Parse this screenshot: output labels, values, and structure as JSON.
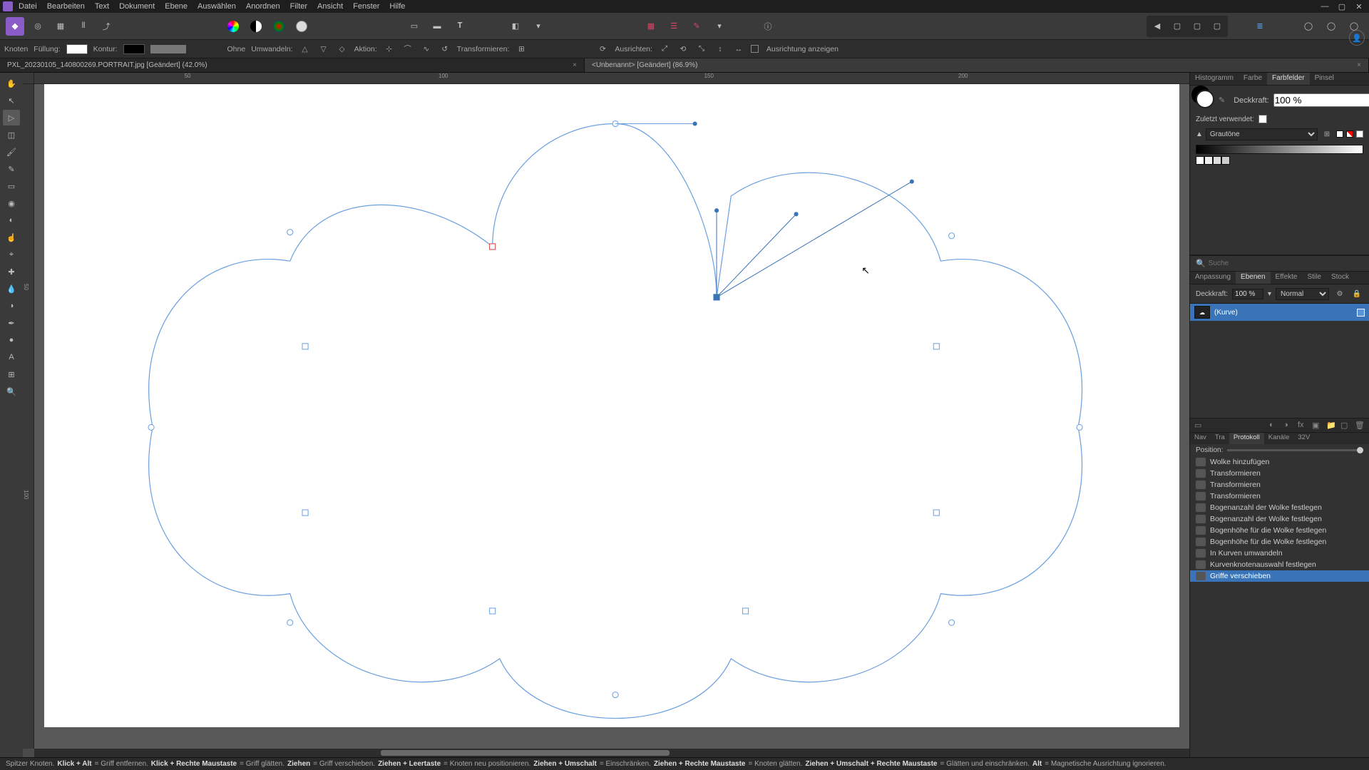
{
  "menu": [
    "Datei",
    "Bearbeiten",
    "Text",
    "Dokument",
    "Ebene",
    "Auswählen",
    "Anordnen",
    "Filter",
    "Ansicht",
    "Fenster",
    "Hilfe"
  ],
  "context": {
    "knoten": "Knoten",
    "fuellung": "Füllung:",
    "kontur": "Kontur:",
    "strokewidth": "Ohne",
    "umwandeln": "Umwandeln:",
    "aktion": "Aktion:",
    "transformieren": "Transformieren:",
    "ausrichten": "Ausrichten:",
    "ausrichtung_anzeigen": "Ausrichtung anzeigen"
  },
  "tabs": [
    {
      "label": "PXL_20230105_140800269.PORTRAIT.jpg [Geändert] (42.0%)",
      "active": false
    },
    {
      "label": "<Unbenannt> [Geändert] (86.9%)",
      "active": true
    }
  ],
  "right": {
    "toptabs": [
      "Histogramm",
      "Farbe",
      "Farbfelder",
      "Pinsel"
    ],
    "toptab_active": 2,
    "deckkraft_lbl": "Deckkraft:",
    "deckkraft_val": "100 %",
    "zuletzt": "Zuletzt verwendet:",
    "palette": "Grautöne",
    "search_ph": "Suche",
    "midtabs": [
      "Anpassung",
      "Ebenen",
      "Effekte",
      "Stile",
      "Stock"
    ],
    "midtab_active": 1,
    "layer_opacity_lbl": "Deckkraft:",
    "layer_opacity_val": "100 %",
    "blend": "Normal",
    "layer_name": "(Kurve)",
    "histtabs": [
      "Nav",
      "Tra",
      "Protokoll",
      "Kanäle",
      "32V"
    ],
    "histtab_active": 2,
    "position": "Position:",
    "history": [
      "Wolke hinzufügen",
      "Transformieren",
      "Transformieren",
      "Transformieren",
      "Bogenanzahl der Wolke festlegen",
      "Bogenanzahl der Wolke festlegen",
      "Bogenhöhe für die Wolke festlegen",
      "Bogenhöhe für die Wolke festlegen",
      "In Kurven umwandeln",
      "Kurvenknotenauswahl festlegen",
      "Griffe verschieben"
    ]
  },
  "ruler_marks": [
    "50",
    "100",
    "150",
    "200"
  ],
  "ruler_v": [
    "50",
    "100"
  ],
  "status": {
    "s1": "Spitzer Knoten.",
    "b1": "Klick + Alt",
    "s2": "= Griff entfernen.",
    "b2": "Klick + Rechte Maustaste",
    "s3": "= Griff glätten.",
    "b3": "Ziehen",
    "s4": "= Griff verschieben.",
    "b4": "Ziehen + Leertaste",
    "s5": "= Knoten neu positionieren.",
    "b5": "Ziehen + Umschalt",
    "s6": "= Einschränken.",
    "b6": "Ziehen + Rechte Maustaste",
    "s7": "= Knoten glätten.",
    "b7": "Ziehen + Umschalt + Rechte Maustaste",
    "s8": "= Glätten und einschränken.",
    "b8": "Alt",
    "s9": "= Magnetische Ausrichtung ignorieren."
  }
}
